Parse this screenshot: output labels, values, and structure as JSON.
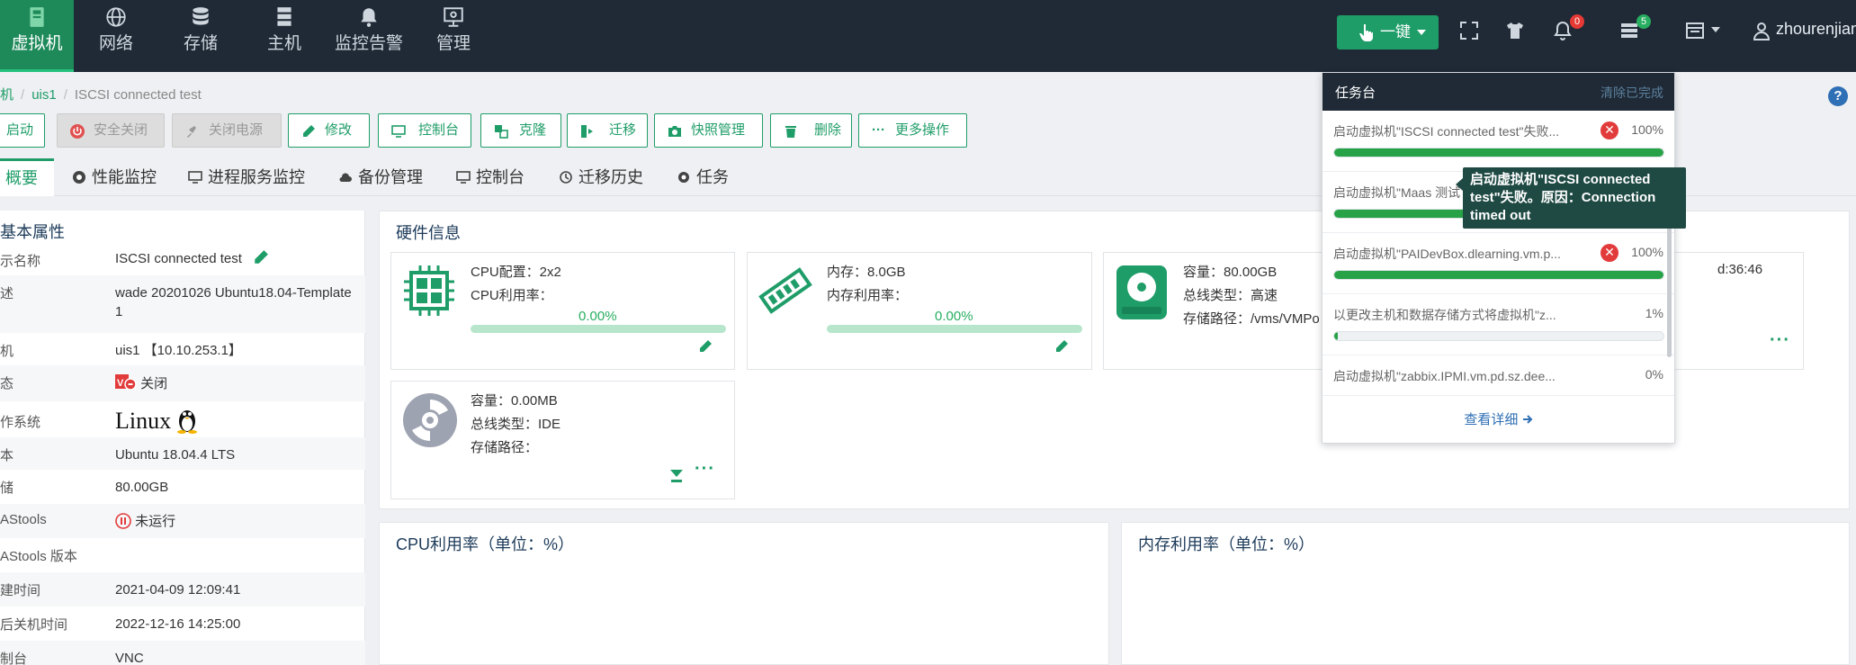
{
  "nav": {
    "items": [
      {
        "label": "虚拟机",
        "icon": "vm-icon"
      },
      {
        "label": "网络",
        "icon": "globe-icon"
      },
      {
        "label": "存储",
        "icon": "database-icon"
      },
      {
        "label": "主机",
        "icon": "server-icon"
      },
      {
        "label": "监控告警",
        "icon": "bell-icon"
      },
      {
        "label": "管理",
        "icon": "monitor-icon"
      }
    ],
    "onekey_label": "一键",
    "alerts_count": "0",
    "tasks_count": "5",
    "user": "zhourenjian"
  },
  "breadcrumb": {
    "part1": "机",
    "part2": "uis1",
    "current": "ISCSI connected test"
  },
  "toolbar": {
    "start": "启动",
    "safe_shutdown": "安全关闭",
    "power_off": "关闭电源",
    "modify": "修改",
    "console": "控制台",
    "clone": "克隆",
    "migrate": "迁移",
    "snapshot": "快照管理",
    "delete": "删除",
    "more": "更多操作"
  },
  "tabs": [
    "概要",
    "性能监控",
    "进程服务监控",
    "备份管理",
    "控制台",
    "迁移历史",
    "任务"
  ],
  "basic": {
    "title": "基本属性",
    "rows": [
      {
        "k": "示名称",
        "v": "ISCSI connected test"
      },
      {
        "k": "述",
        "v": "wade 20201026 Ubuntu18.04-Template 1"
      },
      {
        "k": "机",
        "v": "uis1 【10.10.253.1】"
      },
      {
        "k": "态",
        "v": "关闭"
      },
      {
        "k": "作系统",
        "v": "Linux"
      },
      {
        "k": "本",
        "v": "Ubuntu 18.04.4 LTS"
      },
      {
        "k": "储",
        "v": "80.00GB"
      },
      {
        "k": "AStools",
        "v": "未运行"
      },
      {
        "k": "AStools 版本",
        "v": ""
      },
      {
        "k": "建时间",
        "v": "2021-04-09 12:09:41"
      },
      {
        "k": "后关机时间",
        "v": "2022-12-16 14:25:00"
      },
      {
        "k": "制台",
        "v": "VNC"
      }
    ]
  },
  "hardware": {
    "title": "硬件信息",
    "cpu": {
      "config": "CPU配置：2x2",
      "usage_label": "CPU利用率：",
      "usage": "0.00%"
    },
    "memory": {
      "size": "内存：8.0GB",
      "usage_label": "内存利用率：",
      "usage": "0.00%"
    },
    "disk": {
      "capacity": "容量：80.00GB",
      "bus": "总线类型：高速",
      "path": "存储路径：/vms/VMPo"
    },
    "extra_time": "d:36:46",
    "cdrom": {
      "capacity": "容量：0.00MB",
      "bus": "总线类型：IDE",
      "path": "存储路径："
    }
  },
  "charts": {
    "cpu_title": "CPU利用率（单位：%）",
    "mem_title": "内存利用率（单位：%）"
  },
  "tasks": {
    "title": "任务台",
    "clear": "清除已完成",
    "items": [
      {
        "name": "启动虚拟机\"ISCSI connected test\"失败...",
        "pct": "100%",
        "progress": 100,
        "error": true
      },
      {
        "name": "启动虚拟机\"Maas 测试",
        "pct": "",
        "progress": 100,
        "error": false
      },
      {
        "name": "启动虚拟机\"PAIDevBox.dlearning.vm.p...",
        "pct": "100%",
        "progress": 100,
        "error": true
      },
      {
        "name": "以更改主机和数据存储方式将虚拟机\"z...",
        "pct": "1%",
        "progress": 1,
        "error": false
      },
      {
        "name": "启动虚拟机\"zabbix.IPMI.vm.pd.sz.dee...",
        "pct": "0%",
        "progress": 0,
        "error": false
      }
    ],
    "footer": "查看详细",
    "tooltip": "启动虚拟机\"ISCSI connected test\"失败。原因：Connection timed out"
  },
  "colors": {
    "accent": "#1f9d68",
    "nav_bg": "#1f2a36",
    "error": "#e23b3b"
  }
}
